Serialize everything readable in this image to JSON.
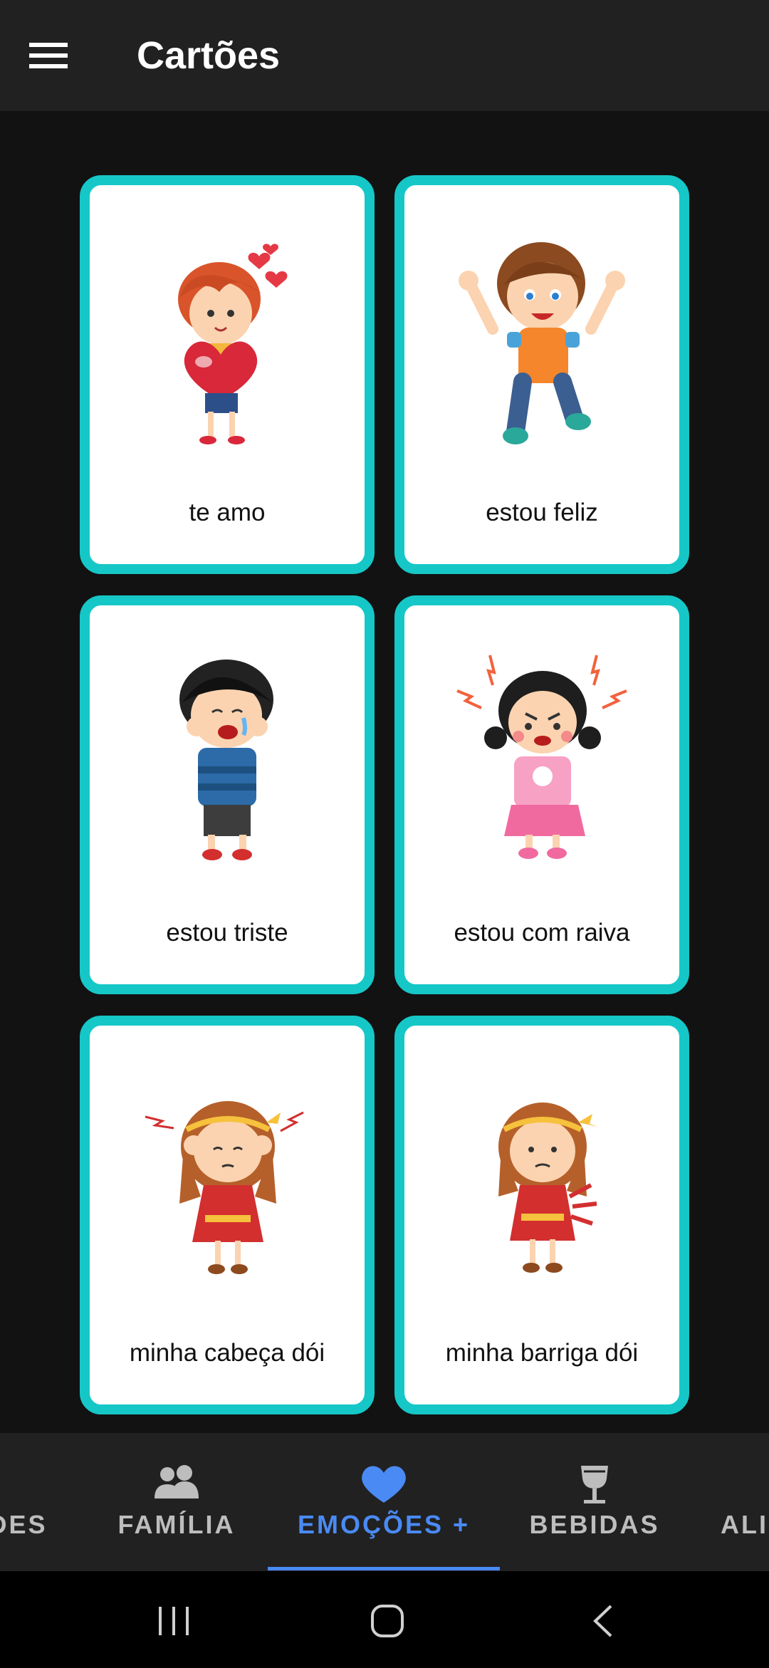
{
  "app_bar": {
    "title": "Cartões",
    "menu_icon": "hamburger-menu-icon"
  },
  "cards": [
    {
      "label": "te amo",
      "image": "boy-holding-heart"
    },
    {
      "label": "estou feliz",
      "image": "happy-boy-waving"
    },
    {
      "label": "estou triste",
      "image": "crying-boy"
    },
    {
      "label": "estou com raiva",
      "image": "angry-girl"
    },
    {
      "label": "minha cabeça dói",
      "image": "girl-headache"
    },
    {
      "label": "minha barriga dói",
      "image": "girl-stomachache"
    }
  ],
  "card_border_color": "#16c7c7",
  "bottom_tabs": [
    {
      "label": "DES",
      "icon": null,
      "active": false
    },
    {
      "label": "FAMÍLIA",
      "icon": "people-icon",
      "active": false
    },
    {
      "label": "EMOÇÕES +",
      "icon": "heart-icon",
      "active": true
    },
    {
      "label": "BEBIDAS",
      "icon": "wine-glass-icon",
      "active": false
    },
    {
      "label": "ALI",
      "icon": null,
      "active": false
    }
  ],
  "accent_color": "#4a8af4",
  "system_nav": {
    "buttons": [
      "recent-apps-icon",
      "home-icon",
      "back-icon"
    ]
  }
}
